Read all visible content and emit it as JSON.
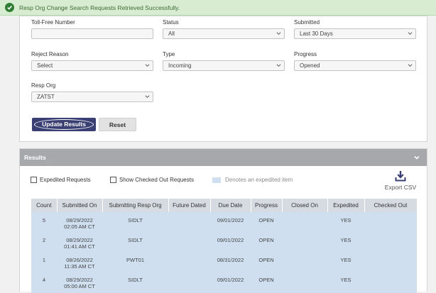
{
  "banner": {
    "message": "Resp Org Change Search Requests Retrieved Successfully.",
    "icon": "check-circle-icon",
    "color": "#2f7d32"
  },
  "filters": {
    "toll_free": {
      "label": "Toll-Free Number",
      "value": ""
    },
    "status": {
      "label": "Status",
      "value": "All"
    },
    "submitted": {
      "label": "Submitted",
      "value": "Last 30 Days"
    },
    "reject_reason": {
      "label": "Reject Reason",
      "value": "Select"
    },
    "type": {
      "label": "Type",
      "value": "Incoming"
    },
    "progress": {
      "label": "Progress",
      "value": "Opened"
    },
    "resp_org": {
      "label": "Resp Org",
      "value": "ZATST"
    }
  },
  "buttons": {
    "update": "Update Results",
    "reset": "Reset",
    "primary_color": "#3a3f73"
  },
  "results": {
    "title": "Results",
    "expedited_label": "Expedited Requests",
    "checked_out_label": "Show Checked Out Requests",
    "legend": "Denotes an expedited item",
    "export": "Export CSV",
    "columns": [
      "Count",
      "Submitted On",
      "Submitting Resp Org",
      "Future Dated",
      "Due Date",
      "Progress",
      "Closed On",
      "Expedited",
      "Checked Out"
    ],
    "rows": [
      {
        "count": "5",
        "submitted_date": "08/29/2022",
        "submitted_time": "02:05 AM CT",
        "resp_org": "SIDLT",
        "future_dated": "",
        "due_date": "09/01/2022",
        "progress": "OPEN",
        "closed_on": "",
        "expedited": "YES",
        "checked_out": ""
      },
      {
        "count": "2",
        "submitted_date": "08/29/2022",
        "submitted_time": "01:41 AM CT",
        "resp_org": "SIDLT",
        "future_dated": "",
        "due_date": "09/01/2022",
        "progress": "OPEN",
        "closed_on": "",
        "expedited": "YES",
        "checked_out": ""
      },
      {
        "count": "1",
        "submitted_date": "08/26/2022",
        "submitted_time": "11:35 AM CT",
        "resp_org": "PWT01",
        "future_dated": "",
        "due_date": "08/31/2022",
        "progress": "OPEN",
        "closed_on": "",
        "expedited": "YES",
        "checked_out": ""
      },
      {
        "count": "4",
        "submitted_date": "08/29/2022",
        "submitted_time": "05:00 AM CT",
        "resp_org": "SIDLT",
        "future_dated": "",
        "due_date": "09/01/2022",
        "progress": "OPEN",
        "closed_on": "",
        "expedited": "YES",
        "checked_out": ""
      }
    ],
    "header_color": "#a6a8ac",
    "expedited_row_color": "#cfdff0"
  }
}
